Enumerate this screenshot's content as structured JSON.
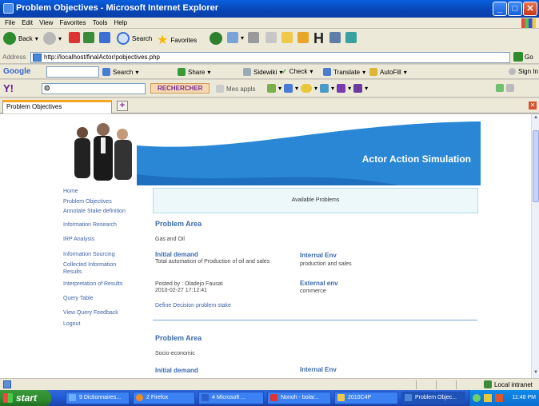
{
  "window": {
    "title": "Problem Objectives - Microsoft Internet Explorer"
  },
  "menu": [
    "File",
    "Edit",
    "View",
    "Favorites",
    "Tools",
    "Help"
  ],
  "toolbar": {
    "back": "Back",
    "search": "Search",
    "favorites": "Favorites"
  },
  "address": {
    "label": "Address",
    "url": "http://localhost/finalActor/pobjectives.php",
    "go": "Go"
  },
  "google_bar": {
    "logo": "Google",
    "search": "Search",
    "share": "Share",
    "sidewiki": "Sidewiki",
    "check": "Check",
    "translate": "Translate",
    "autofill": "AutoFill",
    "signin": "Sign In"
  },
  "yahoo_bar": {
    "logo": "Y!",
    "rechercher": "RECHERCHER",
    "apps": "Mes appls"
  },
  "tab": {
    "label": "Problem Objectives"
  },
  "banner": {
    "title": "Actor Action Simulation"
  },
  "nav": [
    "Home",
    "Problem Objectives",
    "Annotate Stake definition",
    "Information Research",
    "IRP Analysis",
    "Information Sourcing",
    "Collected Information Results",
    "Interpretation of Results",
    "Query Table",
    "View Query Feedback",
    "Logout"
  ],
  "available": "Available Problems",
  "problems": [
    {
      "area_label": "Problem Area",
      "area": "Gas and Oil",
      "initial_label": "Initial demand",
      "initial": "Total automation of Production of oil and sales",
      "internal_label": "Internal Env",
      "internal": "production and sales",
      "posted": "Posted by : Oladejo Fausat",
      "date": "2010-02-27 17:12:41",
      "external_label": "External env",
      "external": "commerce",
      "define_link": "Define Decision problem stake"
    },
    {
      "area_label": "Problem Area",
      "area": "Socio-economic",
      "initial_label": "Initial demand",
      "internal_label": "Internal Env"
    }
  ],
  "status": {
    "zone": "Local intranet"
  },
  "taskbar": {
    "start": "start",
    "items": [
      "9 Dictionnaires...",
      "2 Firefox",
      "4 Microsoft ...",
      "Nonoh - bolar...",
      "2010C4P",
      "Problem Objec..."
    ],
    "clock": "11:48 PM"
  },
  "colors": {
    "accent": "#3b6aad",
    "banner": "#2a87d6",
    "link": "#3e63a8"
  }
}
